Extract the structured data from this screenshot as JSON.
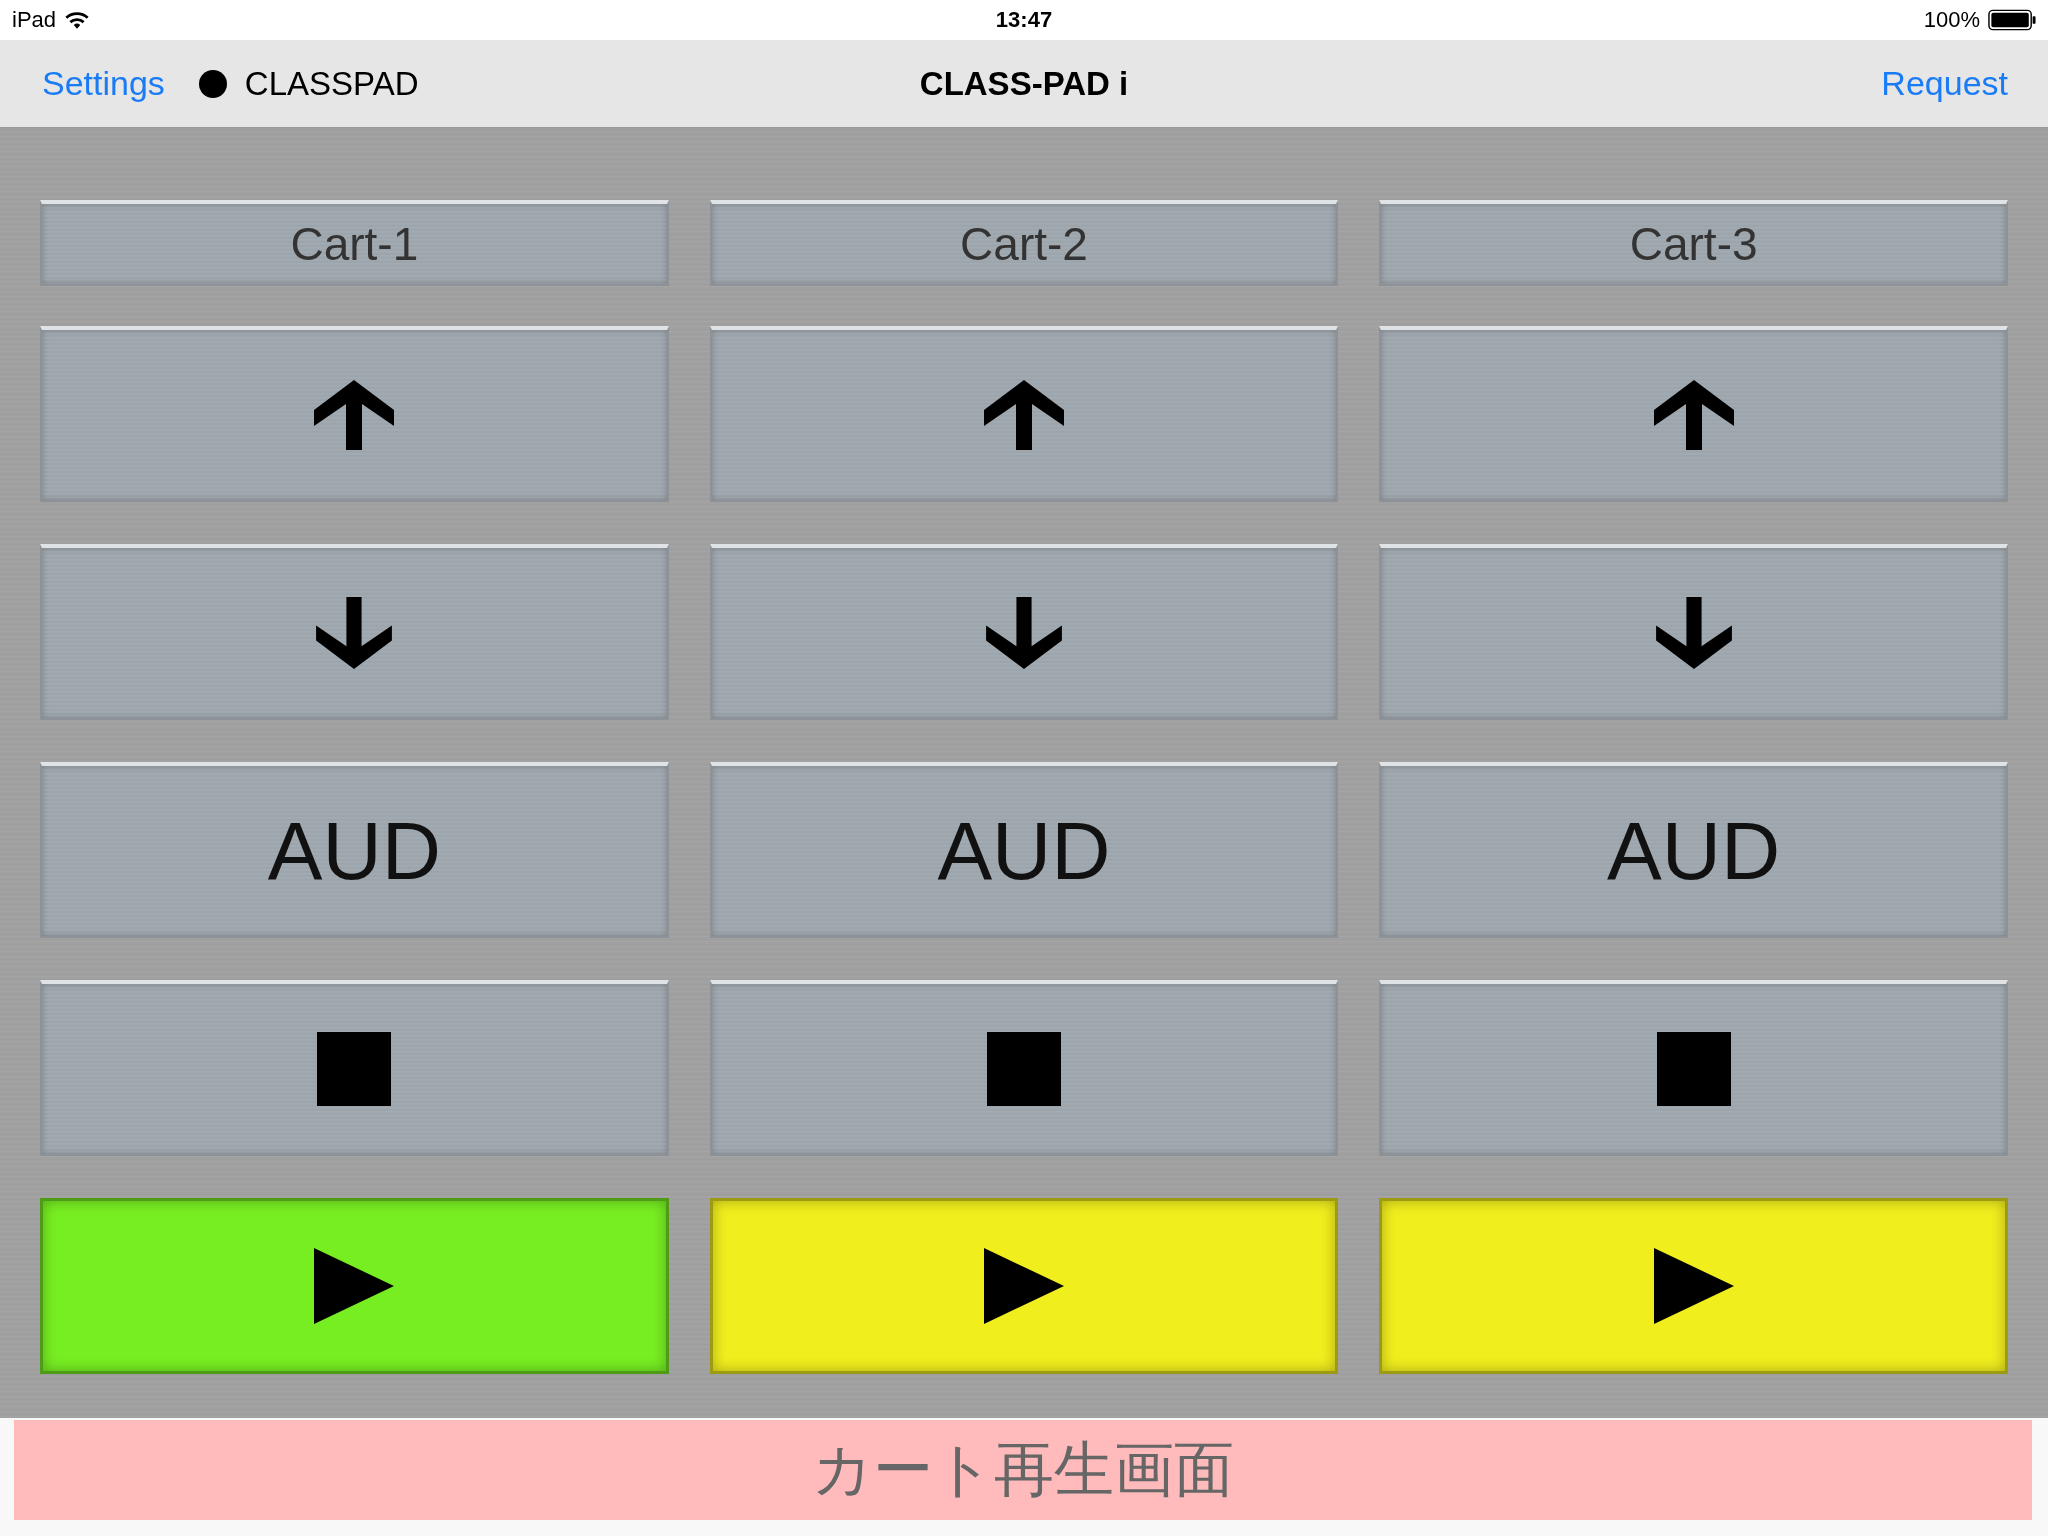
{
  "status_bar": {
    "device": "iPad",
    "time": "13:47",
    "battery": "100%"
  },
  "nav_bar": {
    "left_button": "Settings",
    "device_name": "CLASSPAD",
    "connected": true,
    "title": "CLASS-PAD i",
    "right_button": "Request"
  },
  "carts": [
    {
      "name": "Cart-1",
      "buttons": [
        {
          "kind": "up"
        },
        {
          "kind": "down"
        },
        {
          "kind": "text",
          "label": "AUD"
        },
        {
          "kind": "stop"
        },
        {
          "kind": "play",
          "color": "#77ee22"
        }
      ]
    },
    {
      "name": "Cart-2",
      "buttons": [
        {
          "kind": "up"
        },
        {
          "kind": "down"
        },
        {
          "kind": "text",
          "label": "AUD"
        },
        {
          "kind": "stop"
        },
        {
          "kind": "play",
          "color": "#f1ee1e"
        }
      ]
    },
    {
      "name": "Cart-3",
      "buttons": [
        {
          "kind": "up"
        },
        {
          "kind": "down"
        },
        {
          "kind": "text",
          "label": "AUD"
        },
        {
          "kind": "stop"
        },
        {
          "kind": "play",
          "color": "#f1ee1e"
        }
      ]
    }
  ],
  "caption": "カート再生画面"
}
